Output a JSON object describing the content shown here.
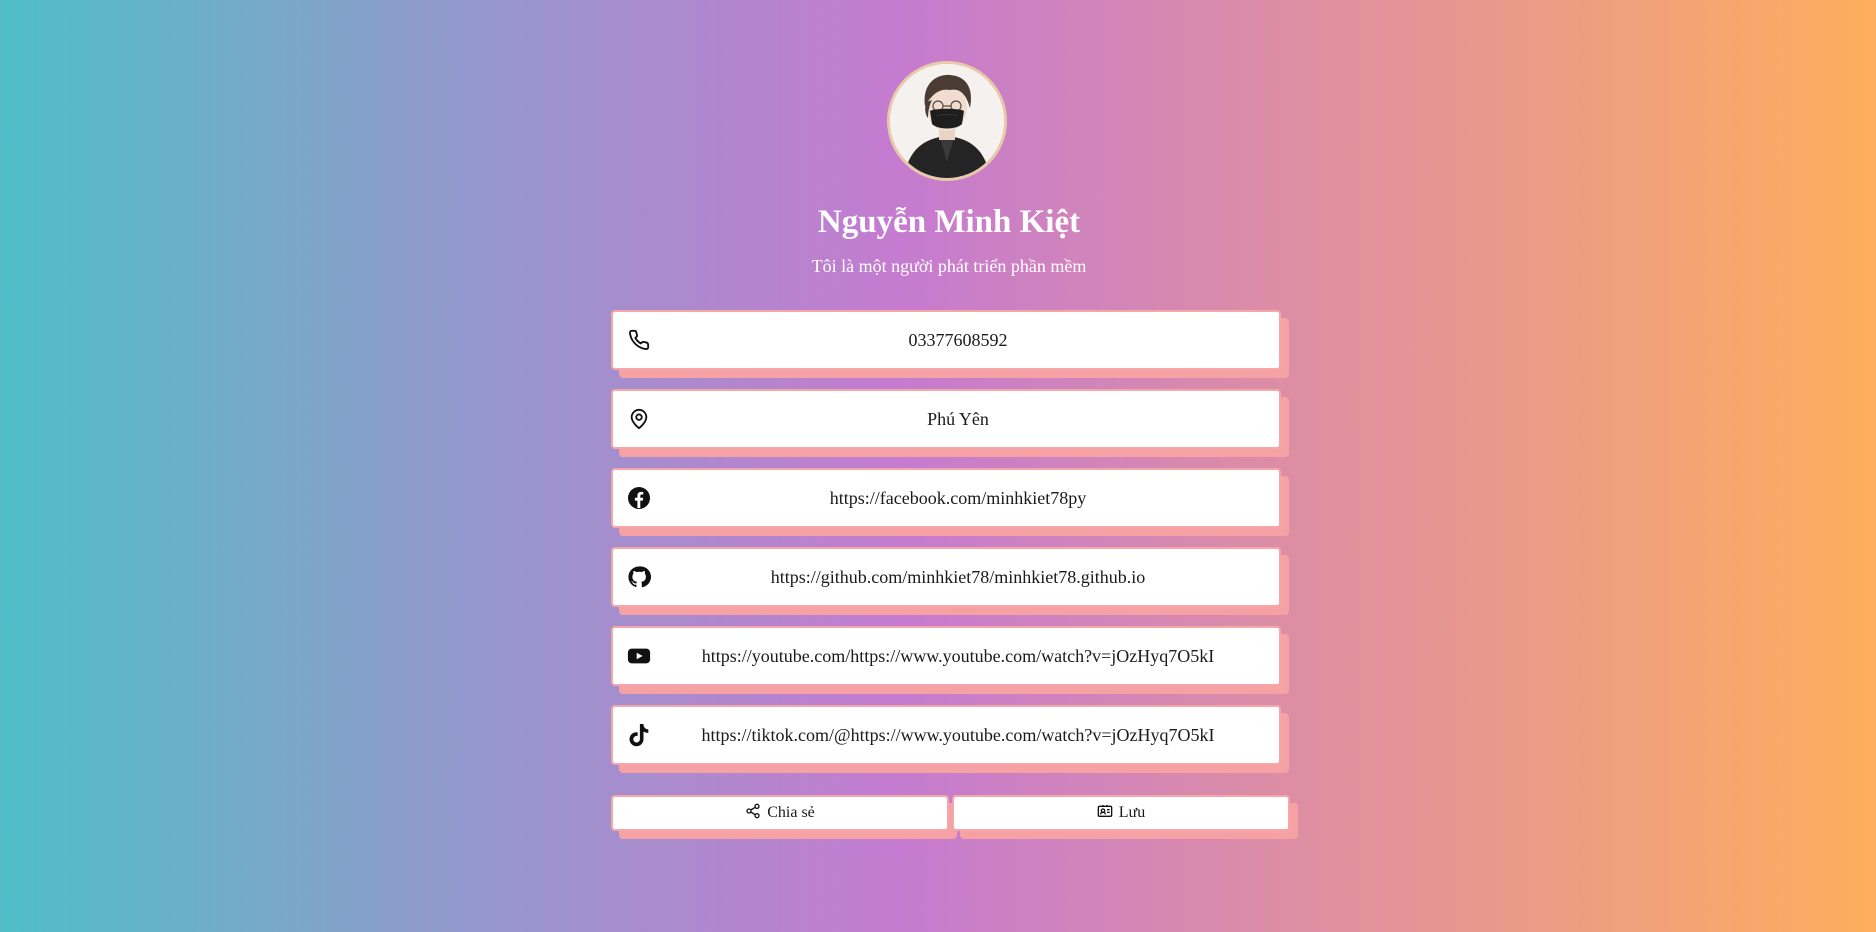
{
  "profile": {
    "name": "Nguyễn Minh Kiệt",
    "bio": "Tôi là một người phát triển phần mềm"
  },
  "contacts": [
    {
      "icon": "phone-icon",
      "text": "03377608592"
    },
    {
      "icon": "location-pin-icon",
      "text": "Phú Yên"
    },
    {
      "icon": "facebook-icon",
      "text": "https://facebook.com/minhkiet78py"
    },
    {
      "icon": "github-icon",
      "text": "https://github.com/minhkiet78/minhkiet78.github.io"
    },
    {
      "icon": "youtube-icon",
      "text": "https://youtube.com/https://www.youtube.com/watch?v=jOzHyq7O5kI"
    },
    {
      "icon": "tiktok-icon",
      "text": "https://tiktok.com/@https://www.youtube.com/watch?v=jOzHyq7O5kI"
    }
  ],
  "actions": {
    "share_label": "Chia sẻ",
    "save_label": "Lưu"
  },
  "colors": {
    "card_border": "#f4a6a8",
    "card_shadow": "#f6a2a4",
    "gradient_left": "#4fbfc8",
    "gradient_mid": "#c57bd0",
    "gradient_right": "#feae5c"
  }
}
